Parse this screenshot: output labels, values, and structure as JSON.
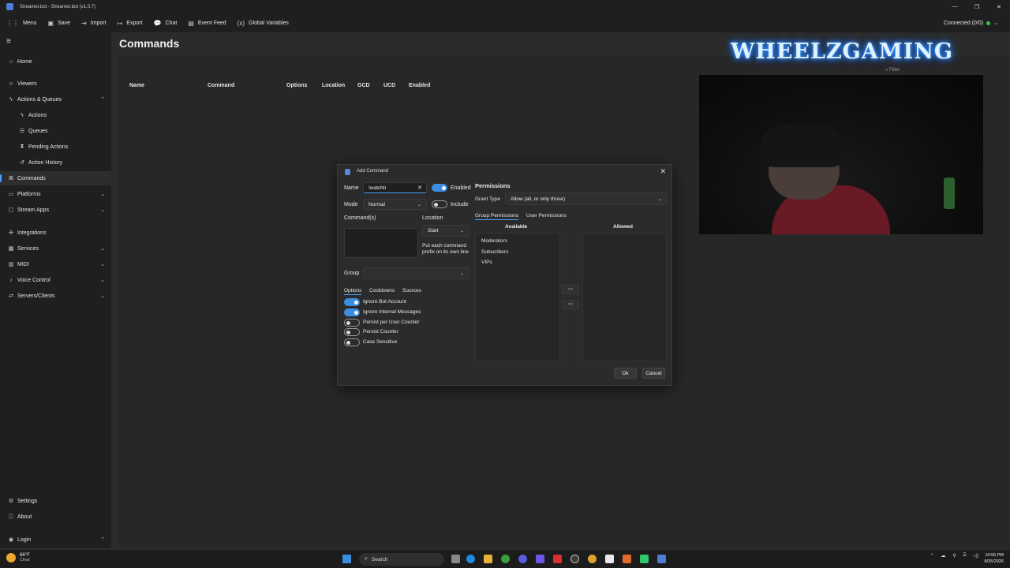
{
  "window": {
    "title": "Streamer.bot - Streamer.bot (v1.0.7)",
    "controls": [
      "—",
      "❐",
      "✕"
    ]
  },
  "toolbar": {
    "menu": "Menu",
    "save": "Save",
    "import": "Import",
    "export": "Export",
    "chat": "Chat",
    "event_feed": "Event Feed",
    "global_variables": "Global Variables",
    "connected": "Connected (0/0)",
    "status_color": "#2ecc40"
  },
  "sidebar": {
    "items": [
      {
        "label": "Home",
        "icon": "home-icon"
      },
      {
        "label": "Viewers",
        "icon": "viewers-icon"
      },
      {
        "label": "Actions & Queues",
        "icon": "lightning-icon",
        "expanded": true
      },
      {
        "label": "Actions",
        "icon": "bolt-icon"
      },
      {
        "label": "Queues",
        "icon": "queue-icon"
      },
      {
        "label": "Pending Actions",
        "icon": "pending-icon"
      },
      {
        "label": "Action History",
        "icon": "history-icon"
      },
      {
        "label": "Commands",
        "icon": "terminal-icon",
        "active": true
      },
      {
        "label": "Platforms",
        "icon": "platform-icon"
      },
      {
        "label": "Stream Apps",
        "icon": "apps-icon"
      },
      {
        "label": "Integrations",
        "icon": "integrations-icon"
      },
      {
        "label": "Services",
        "icon": "services-icon"
      },
      {
        "label": "MIDI",
        "icon": "midi-icon"
      },
      {
        "label": "Voice Control",
        "icon": "mic-icon"
      },
      {
        "label": "Servers/Clients",
        "icon": "server-icon"
      },
      {
        "label": "Settings",
        "icon": "gear-icon"
      },
      {
        "label": "About",
        "icon": "info-icon"
      },
      {
        "label": "Login",
        "icon": "user-icon"
      }
    ]
  },
  "main": {
    "title": "Commands",
    "columns": [
      "Name",
      "Command",
      "Options",
      "Location",
      "GCD",
      "UCD",
      "Enabled"
    ],
    "filter_placeholder": "Filter"
  },
  "overlay": {
    "brand": "WHEELZGAMING"
  },
  "dialog": {
    "title": "Add Command",
    "name_label": "Name",
    "name_value": "!watchti",
    "enabled_label": "Enabled",
    "enabled": true,
    "mode_label": "Mode",
    "mode_value": "Normal",
    "include_label": "Include",
    "include": false,
    "commands_label": "Command(s)",
    "location_label": "Location",
    "location_value": "Start",
    "prefix_hint": "Put each command prefix on its own line",
    "group_label": "Group",
    "group_value": "",
    "tabs": [
      "Options",
      "Cooldowns",
      "Sources"
    ],
    "options": [
      {
        "label": "Ignore Bot Account",
        "on": true
      },
      {
        "label": "Ignore Internal Messages",
        "on": true
      },
      {
        "label": "Persist per User Counter",
        "on": false
      },
      {
        "label": "Persist Counter",
        "on": false
      },
      {
        "label": "Case Sensitive",
        "on": false
      }
    ],
    "permissions": {
      "heading": "Permissions",
      "grant_type_label": "Grant Type",
      "grant_type_value": "Allow (all, or only those)",
      "tabs": [
        "Group Permissions",
        "User Permissions"
      ],
      "available_label": "Available",
      "allowed_label": "Allowed",
      "available": [
        "Moderators",
        "Subscribers",
        "VIPs"
      ],
      "move_right": ">>",
      "move_left": "<<"
    },
    "ok": "Ok",
    "cancel": "Cancel"
  },
  "taskbar": {
    "temperature": "66°F",
    "condition": "Clear",
    "search_placeholder": "Search",
    "time": "10:55 PM",
    "date": "8/25/2026"
  }
}
